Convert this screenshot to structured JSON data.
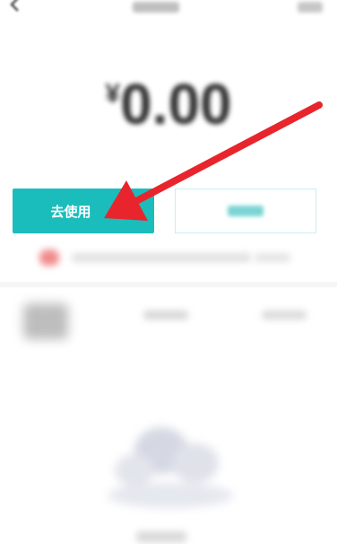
{
  "balance": {
    "currency_symbol": "¥",
    "amount": "0.00"
  },
  "actions": {
    "use_button_label": "去使用"
  },
  "colors": {
    "accent": "#1abdbb",
    "annotation_arrow": "#e8252c"
  },
  "icons": {
    "back": "chevron-left-icon"
  }
}
